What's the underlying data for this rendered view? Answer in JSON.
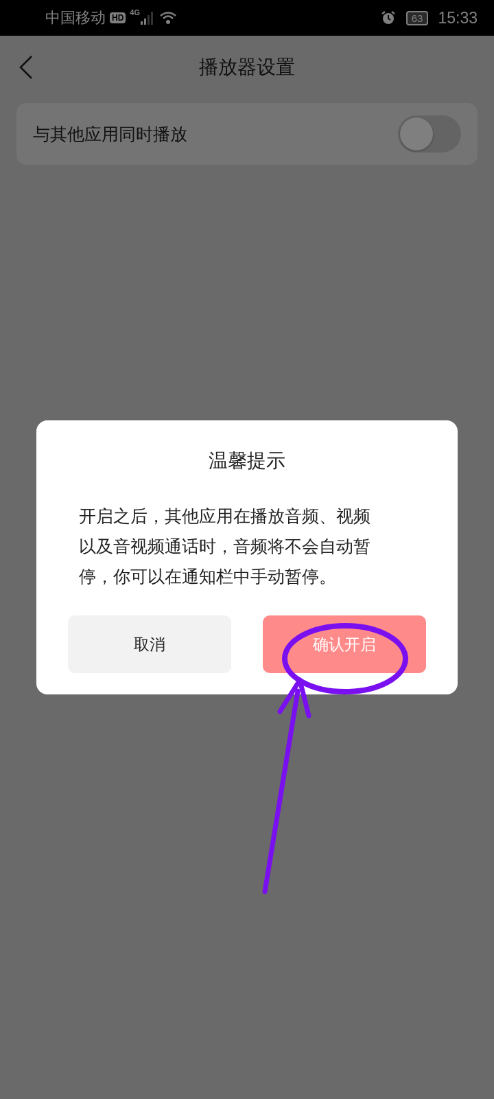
{
  "status_bar": {
    "carrier": "中国移动",
    "hd_badge": "HD",
    "network": "4G",
    "battery": "63",
    "time": "15:33"
  },
  "header": {
    "title": "播放器设置"
  },
  "settings": [
    {
      "label": "与其他应用同时播放",
      "on": false
    }
  ],
  "dialog": {
    "title": "温馨提示",
    "message": "开启之后，其他应用在播放音频、视频以及音视频通话时，音频将不会自动暂停，你可以在通知栏中手动暂停。",
    "buttons": [
      {
        "label": "取消",
        "kind": "secondary"
      },
      {
        "label": "确认开启",
        "kind": "primary"
      }
    ]
  }
}
